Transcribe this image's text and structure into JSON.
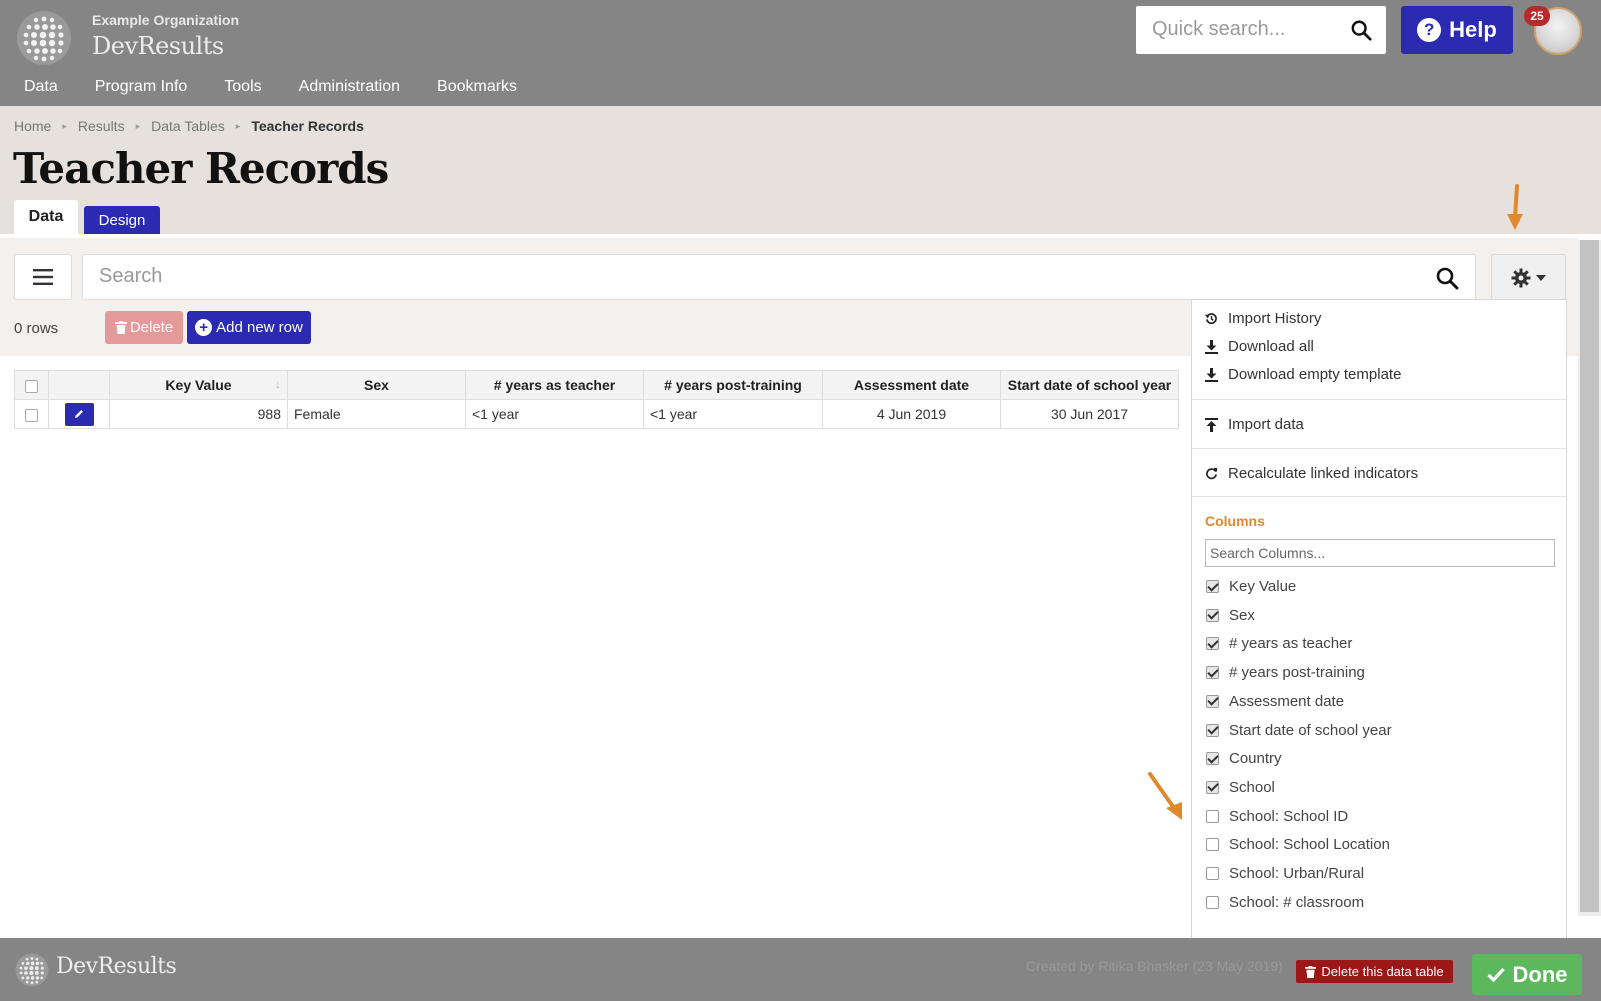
{
  "header": {
    "org_name": "Example Organization",
    "app_name": "DevResults",
    "quick_search_placeholder": "Quick search...",
    "help_label": "Help",
    "notification_count": "25"
  },
  "nav": {
    "items": [
      "Data",
      "Program Info",
      "Tools",
      "Administration",
      "Bookmarks"
    ]
  },
  "breadcrumb": {
    "items": [
      "Home",
      "Results",
      "Data Tables"
    ],
    "current": "Teacher Records"
  },
  "page": {
    "title": "Teacher Records",
    "tabs": [
      "Data",
      "Design"
    ]
  },
  "toolbar": {
    "search_placeholder": "Search",
    "rows_count": "0 rows",
    "delete_label": "Delete",
    "add_label": "Add new row"
  },
  "table": {
    "columns": [
      "Key Value",
      "Sex",
      "# years as teacher",
      "# years post-training",
      "Assessment date",
      "Start date of school year"
    ],
    "rows": [
      [
        "988",
        "Female",
        "<1 year",
        "<1 year",
        "4 Jun 2019",
        "30 Jun 2017"
      ]
    ]
  },
  "dropdown": {
    "actions": [
      "Import History",
      "Download all",
      "Download empty template",
      "Import data",
      "Recalculate linked indicators"
    ],
    "columns_heading": "Columns",
    "columns_search_placeholder": "Search Columns...",
    "columns": [
      {
        "label": "Key Value",
        "checked": true
      },
      {
        "label": "Sex",
        "checked": true
      },
      {
        "label": "# years as teacher",
        "checked": true
      },
      {
        "label": "# years post-training",
        "checked": true
      },
      {
        "label": "Assessment date",
        "checked": true
      },
      {
        "label": "Start date of school year",
        "checked": true
      },
      {
        "label": "Country",
        "checked": true
      },
      {
        "label": "School",
        "checked": true
      },
      {
        "label": "School: School ID",
        "checked": false
      },
      {
        "label": "School: School Location",
        "checked": false
      },
      {
        "label": "School: Urban/Rural",
        "checked": false
      },
      {
        "label": "School: # classroom",
        "checked": false
      }
    ]
  },
  "footer": {
    "app_name": "DevResults",
    "created_by": "Created by Ritika Bhasker (23 May 2019)",
    "delete_table_label": "Delete this data table",
    "done_label": "Done"
  },
  "colors": {
    "brand_blue": "#2a2bb0",
    "header_gray": "#858585",
    "annotation_arrow": "#e0892b",
    "danger": "#9c1717",
    "success": "#5cb85c"
  }
}
